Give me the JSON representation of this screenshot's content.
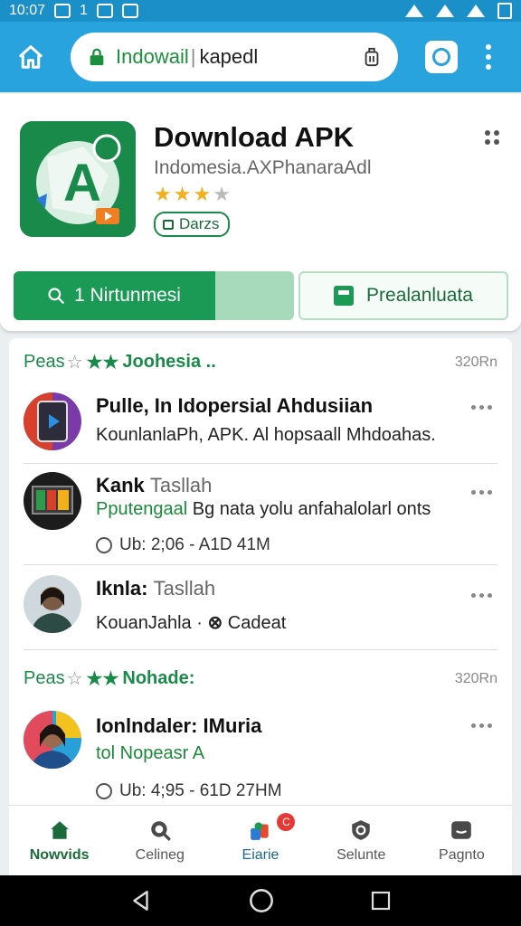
{
  "status_bar": {
    "time": "10:07",
    "indicator": "1"
  },
  "toolbar": {
    "url_host": "Indowail",
    "url_path": "kapedl"
  },
  "app": {
    "title": "Download APK",
    "subtitle": "Indomesia.AXPhanaraAdl",
    "rating": 3,
    "max_rating": 5,
    "badge": "Darzs",
    "primary_button": "1 Nirtunmesi",
    "primary_progress": 0.72,
    "secondary_button": "Prealanluata"
  },
  "sections": [
    {
      "prefix": "Peas",
      "title": "Joohesia ..",
      "count": "320Rn"
    },
    {
      "prefix": "Peas",
      "title": "Nohade:",
      "count": "320Rn"
    }
  ],
  "posts": [
    {
      "title": "Pulle, In Idopersial Ahdusiian",
      "title_light": "",
      "line": "KounlanlaPh, APK. Al hopsaall Mhdoahas.",
      "meta": ""
    },
    {
      "title": "Kank",
      "title_light": "Tasllah",
      "line": "Pputengaal",
      "line_dark": "Bg nata yolu anfahalolarl onts",
      "meta": "Ub: 2;06 - A1D 41M"
    },
    {
      "title": "Iknla:",
      "title_light": "Tasllah",
      "line": "KouanJahla ·",
      "line_dark": "Cadeat",
      "meta": ""
    },
    {
      "title": "Ionlndaler: IMuria",
      "title_light": "",
      "line": "tol Nopeasr A",
      "meta": "Ub: 4;95 - 61D 27HM"
    }
  ],
  "bottom_nav": [
    {
      "label": "Nowvids",
      "icon": "home-icon",
      "active": true
    },
    {
      "label": "Celineg",
      "icon": "search-icon",
      "active": false
    },
    {
      "label": "Eiarie",
      "icon": "share-icon",
      "active": false,
      "badge": "C"
    },
    {
      "label": "Selunte",
      "icon": "shield-icon",
      "active": false
    },
    {
      "label": "Pagnto",
      "icon": "profile-icon",
      "active": false
    }
  ],
  "colors": {
    "toolbar": "#29a3dd",
    "status_bar": "#1b8fc7",
    "accent": "#1a9a55"
  }
}
